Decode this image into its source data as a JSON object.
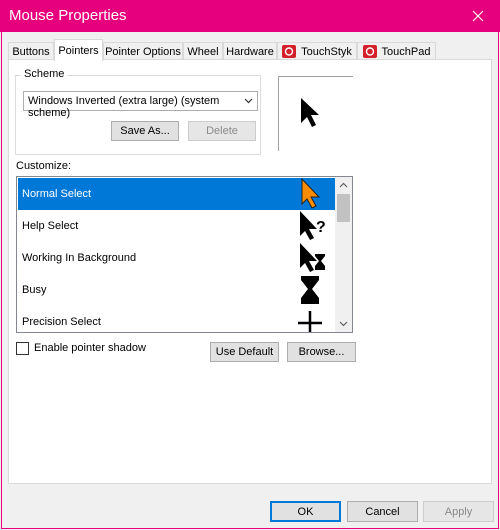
{
  "window": {
    "title": "Mouse Properties"
  },
  "tabs": [
    {
      "label": "Buttons"
    },
    {
      "label": "Pointers"
    },
    {
      "label": "Pointer Options"
    },
    {
      "label": "Wheel"
    },
    {
      "label": "Hardware"
    },
    {
      "label": "TouchStyk"
    },
    {
      "label": "TouchPad"
    }
  ],
  "scheme": {
    "group_label": "Scheme",
    "selected": "Windows Inverted (extra large) (system scheme)",
    "save_as_label": "Save As...",
    "delete_label": "Delete"
  },
  "customize": {
    "label": "Customize:",
    "items": [
      {
        "label": "Normal Select",
        "icon": "arrow-pointer-icon"
      },
      {
        "label": "Help Select",
        "icon": "help-pointer-icon"
      },
      {
        "label": "Working In Background",
        "icon": "working-pointer-icon"
      },
      {
        "label": "Busy",
        "icon": "hourglass-icon"
      },
      {
        "label": "Precision Select",
        "icon": "crosshair-icon"
      }
    ]
  },
  "shadow": {
    "label": "Enable pointer shadow",
    "checked": false
  },
  "buttons": {
    "use_default": "Use Default",
    "browse": "Browse...",
    "ok": "OK",
    "cancel": "Cancel",
    "apply": "Apply"
  },
  "colors": {
    "title_bar": "#e6007e",
    "selection": "#0078d7",
    "pointer_accent": "#ff8c00"
  }
}
